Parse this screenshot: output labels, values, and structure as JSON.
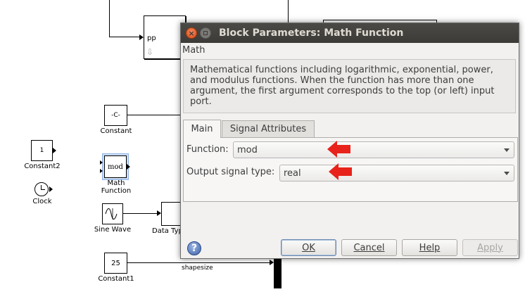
{
  "canvas": {
    "blocks": {
      "pp_port": "pp",
      "constant_c": "-C-",
      "constant_c_label": "Constant",
      "constant2_value": "1",
      "constant2_label": "Constant2",
      "clock_label": "Clock",
      "math_icon": "mod",
      "math_label_line1": "Math",
      "math_label_line2": "Function",
      "sine_label": "Sine Wave",
      "datatype_label": "Data Typ",
      "constant1_value": "25",
      "constant1_label": "Constant1",
      "shapesize_label": "shapesize"
    }
  },
  "dialog": {
    "title": "Block Parameters: Math Function",
    "section": "Math",
    "description": "Mathematical functions including logarithmic, exponential, power, and modulus functions.  When the function has more than one argument, the first argument corresponds to the top (or left) input port.",
    "tabs": [
      "Main",
      "Signal Attributes"
    ],
    "function_label": "Function:",
    "function_value": "mod",
    "output_label": "Output signal type:",
    "output_value": "real",
    "buttons": {
      "ok": "OK",
      "cancel": "Cancel",
      "help": "Help",
      "apply": "Apply"
    },
    "help_icon": "?"
  },
  "colors": {
    "titlebar": "#3c3b37",
    "close": "#dd4814",
    "annotation_arrow": "#e8231b",
    "selected_block": "#8fb3e8"
  }
}
